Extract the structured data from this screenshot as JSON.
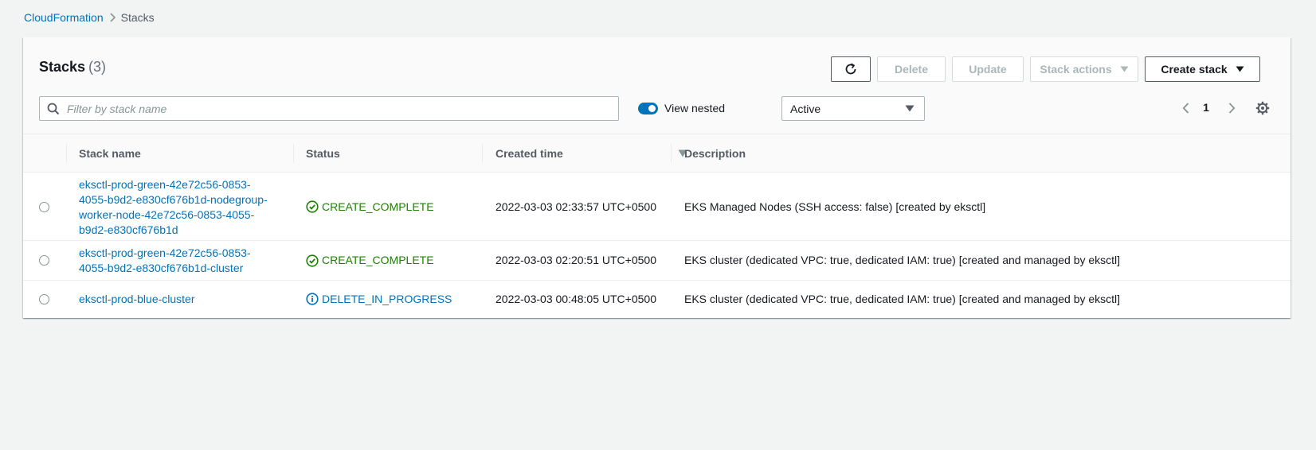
{
  "breadcrumb": {
    "root": "CloudFormation",
    "current": "Stacks"
  },
  "header": {
    "title": "Stacks",
    "count": "(3)"
  },
  "toolbar": {
    "delete_label": "Delete",
    "update_label": "Update",
    "stack_actions_label": "Stack actions",
    "create_stack_label": "Create stack"
  },
  "filter": {
    "placeholder": "Filter by stack name",
    "value": ""
  },
  "view_nested": {
    "label": "View nested",
    "enabled": true
  },
  "status_filter": {
    "selected": "Active"
  },
  "pagination": {
    "page": "1"
  },
  "table": {
    "columns": [
      "Stack name",
      "Status",
      "Created time",
      "Description"
    ],
    "rows": [
      {
        "name": "eksctl-prod-green-42e72c56-0853-4055-b9d2-e830cf676b1d-nodegroup-worker-node-42e72c56-0853-4055-b9d2-e830cf676b1d",
        "name_lines": [
          "eksctl-prod-green-42e72c56-0853-",
          "4055-b9d2-e830cf676b1d-nodegroup-",
          "worker-node-42e72c56-0853-4055-",
          "b9d2-e830cf676b1d"
        ],
        "status": "CREATE_COMPLETE",
        "status_type": "success",
        "created": "2022-03-03 02:33:57 UTC+0500",
        "description": "EKS Managed Nodes (SSH access: false) [created by eksctl]"
      },
      {
        "name": "eksctl-prod-green-42e72c56-0853-4055-b9d2-e830cf676b1d-cluster",
        "name_lines": [
          "eksctl-prod-green-42e72c56-0853-",
          "4055-b9d2-e830cf676b1d-cluster"
        ],
        "status": "CREATE_COMPLETE",
        "status_type": "success",
        "created": "2022-03-03 02:20:51 UTC+0500",
        "description": "EKS cluster (dedicated VPC: true, dedicated IAM: true) [created and managed by eksctl]"
      },
      {
        "name": "eksctl-prod-blue-cluster",
        "name_lines": [
          "eksctl-prod-blue-cluster"
        ],
        "status": "DELETE_IN_PROGRESS",
        "status_type": "info",
        "created": "2022-03-03 00:48:05 UTC+0500",
        "description": "EKS cluster (dedicated VPC: true, dedicated IAM: true) [created and managed by eksctl]"
      }
    ]
  },
  "icons": {
    "refresh": "refresh-icon",
    "search": "search-icon",
    "caret": "caret-down-icon",
    "prev": "chevron-left-icon",
    "next": "chevron-right-icon",
    "settings": "gear-icon",
    "success": "check-circle-icon",
    "info": "info-circle-icon",
    "sort": "sort-down-icon",
    "breadcrumb_sep": "chevron-right-icon"
  },
  "colors": {
    "link": "#0073bb",
    "success": "#1d8102",
    "info": "#0073bb",
    "toggle": "#0073bb"
  }
}
